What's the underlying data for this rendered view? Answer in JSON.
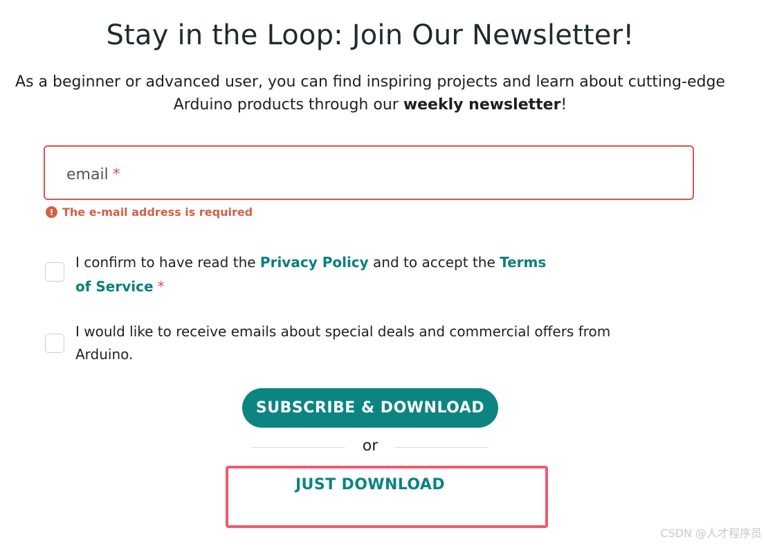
{
  "header": {
    "title": "Stay in the Loop: Join Our Newsletter!",
    "intro_part1": "As a beginner or advanced user, you can find inspiring projects and learn about cutting-edge Arduino products through our ",
    "intro_bold": "weekly newsletter",
    "intro_end": "!"
  },
  "form": {
    "email_label": "email",
    "required_mark": "*",
    "email_value": "",
    "error_icon": "!",
    "error_message": "The e-mail address is required",
    "consent": {
      "text1": "I confirm to have read the ",
      "privacy_link": "Privacy Policy",
      "text2": " and to accept the ",
      "terms_link": "Terms of Service",
      "required_mark": "*",
      "checked": false
    },
    "marketing": {
      "text": "I would like to receive emails about special deals and commercial offers from Arduino.",
      "checked": false
    },
    "subscribe_label": "SUBSCRIBE & DOWNLOAD",
    "or_text": "or",
    "just_download_label": "JUST DOWNLOAD"
  },
  "colors": {
    "accent": "#0b8482",
    "error": "#d35f45",
    "highlight_frame": "#f05a6e"
  },
  "watermark": "CSDN @人才程序员"
}
